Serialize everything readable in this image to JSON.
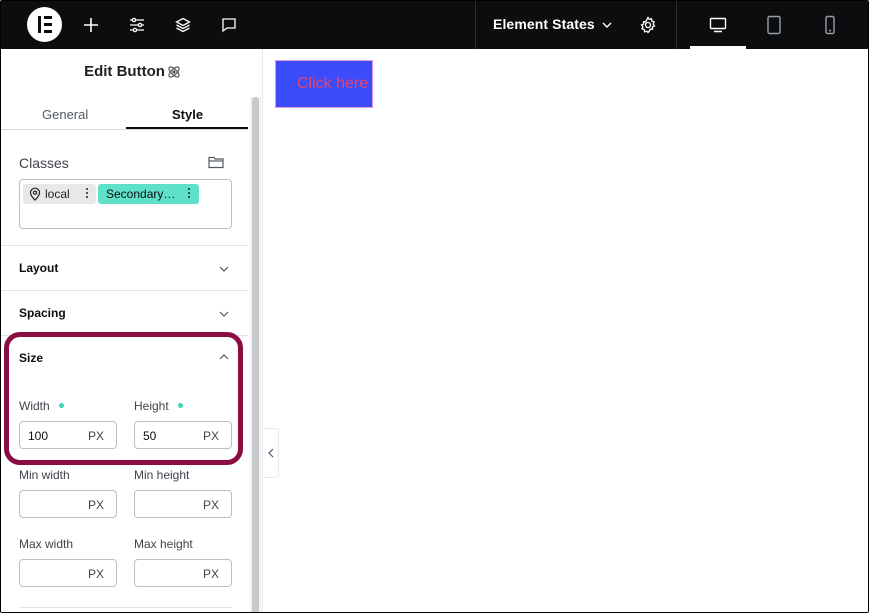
{
  "topbar": {
    "add_icon": "plus-icon",
    "settings_icon": "sliders-icon",
    "structure_icon": "layers-icon",
    "notes_icon": "comment-icon",
    "document_title": "Element States",
    "site_settings_icon": "gear-icon",
    "devices": [
      "desktop",
      "tablet",
      "mobile"
    ],
    "active_device": "desktop"
  },
  "panel": {
    "title": "Edit Button",
    "tabs": [
      {
        "label": "General",
        "active": false
      },
      {
        "label": "Style",
        "active": true
      }
    ],
    "classes": {
      "label": "Classes",
      "chips": [
        {
          "label": "local"
        },
        {
          "label": "Secondary…"
        }
      ]
    },
    "sections": {
      "layout": "Layout",
      "spacing": "Spacing",
      "size": "Size"
    },
    "size": {
      "width_label": "Width",
      "width_value": "100",
      "width_unit": "PX",
      "height_label": "Height",
      "height_value": "50",
      "height_unit": "PX",
      "min_width_label": "Min width",
      "min_width_unit": "PX",
      "min_height_label": "Min height",
      "min_height_unit": "PX",
      "max_width_label": "Max width",
      "max_width_unit": "PX",
      "max_height_label": "Max height",
      "max_height_unit": "PX"
    }
  },
  "canvas": {
    "button_label": "Click here"
  },
  "colors": {
    "topbar_bg": "#0c0d0e",
    "highlight": "#8b0e42",
    "chip_secondary": "#5ee0c9",
    "canvas_button_bg": "#3d4cfa",
    "canvas_button_text": "#e6436b"
  }
}
